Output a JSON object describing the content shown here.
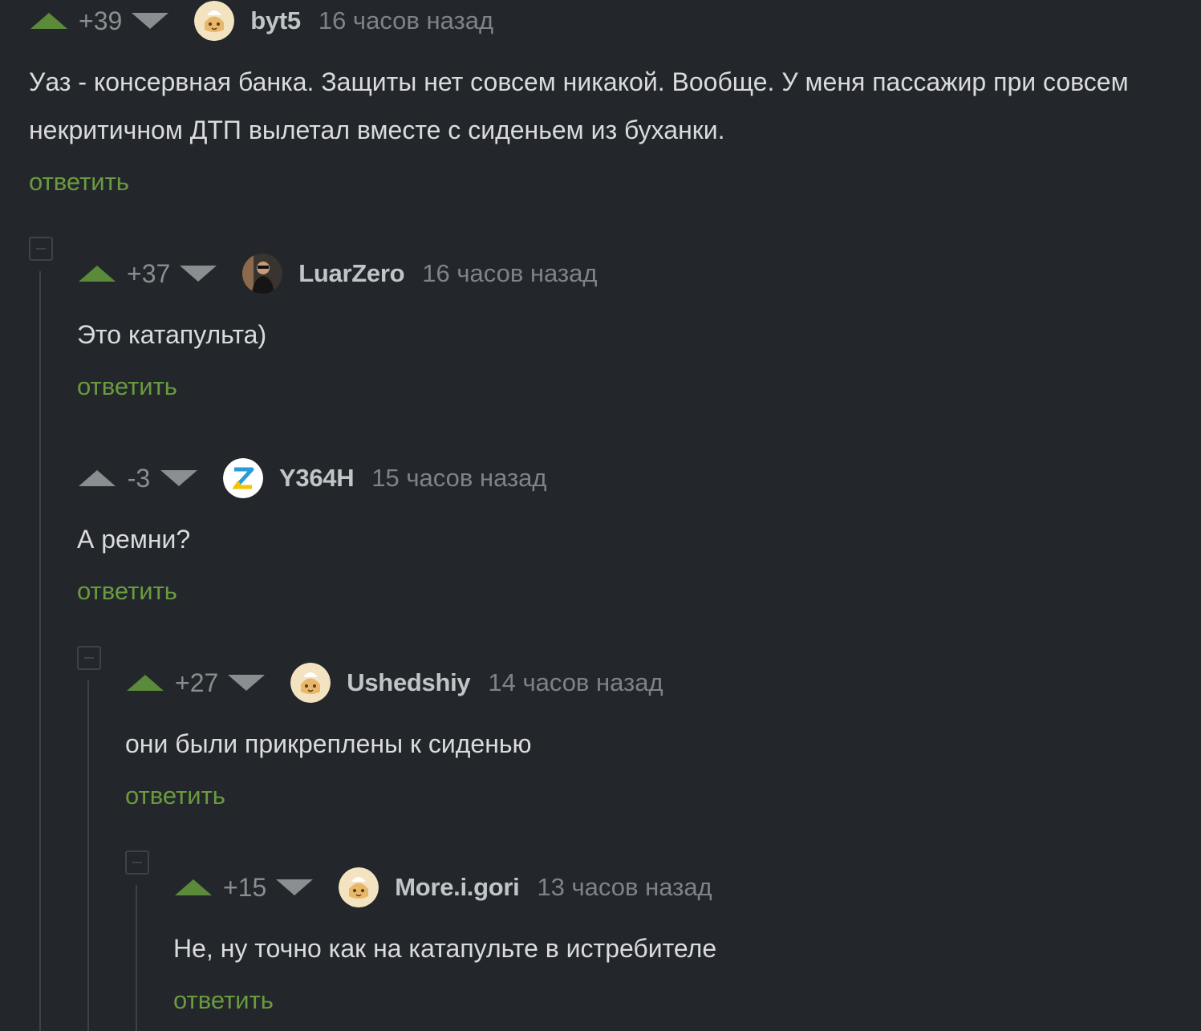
{
  "comments": [
    {
      "score": "+39",
      "author": "byt5",
      "time": "16 часов назад",
      "text": "Уаз - консервная банка. Защиты нет совсем никакой. Вообще. У меня пассажир при совсем некритичном ДТП вылетал вместе с сиденьем из буханки.",
      "reply": "ответить",
      "avatar": "cat-avatar-icon"
    },
    {
      "score": "+37",
      "author": "LuarZero",
      "time": "16 часов назад",
      "text": "Это катапульта)",
      "reply": "ответить",
      "avatar": "photo-avatar-icon"
    },
    {
      "score": "-3",
      "author": "Y364H",
      "time": "15 часов назад",
      "text": "А ремни?",
      "reply": "ответить",
      "avatar": "z-letter-avatar-icon"
    },
    {
      "score": "+27",
      "author": "Ushedshiy",
      "time": "14 часов назад",
      "text": "они были прикреплены к сиденью",
      "reply": "ответить",
      "avatar": "cat-avatar-icon"
    },
    {
      "score": "+15",
      "author": "More.i.gori",
      "time": "13 часов назад",
      "text": "Не, ну точно как на катапульте в истребителе",
      "reply": "ответить",
      "avatar": "cat-avatar-icon"
    }
  ],
  "colors": {
    "background": "#23272b",
    "upvote_active": "#5b8a3a",
    "reply_link": "#6a9a3f",
    "muted": "#8b8e91",
    "thread_line": "#3d4248"
  }
}
